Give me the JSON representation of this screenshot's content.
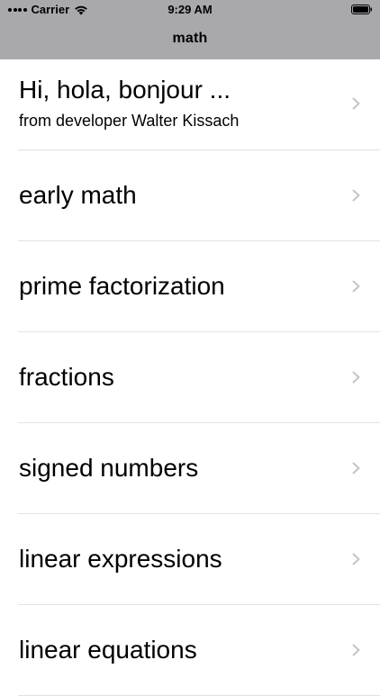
{
  "status_bar": {
    "carrier": "Carrier",
    "time": "9:29 AM",
    "icons": [
      "signal-dots-icon",
      "wifi-icon",
      "battery-icon"
    ]
  },
  "nav": {
    "title": "math"
  },
  "list": {
    "items": [
      {
        "label": "Hi, hola, bonjour ...",
        "subtitle": "from developer Walter Kissach"
      },
      {
        "label": "early math"
      },
      {
        "label": "prime factorization"
      },
      {
        "label": "fractions"
      },
      {
        "label": "signed numbers"
      },
      {
        "label": "linear expressions"
      },
      {
        "label": "linear equations"
      }
    ]
  },
  "colors": {
    "header_bg": "#a9a9ad",
    "separator": "#e2e2e5",
    "chevron": "#c4c4c7"
  }
}
